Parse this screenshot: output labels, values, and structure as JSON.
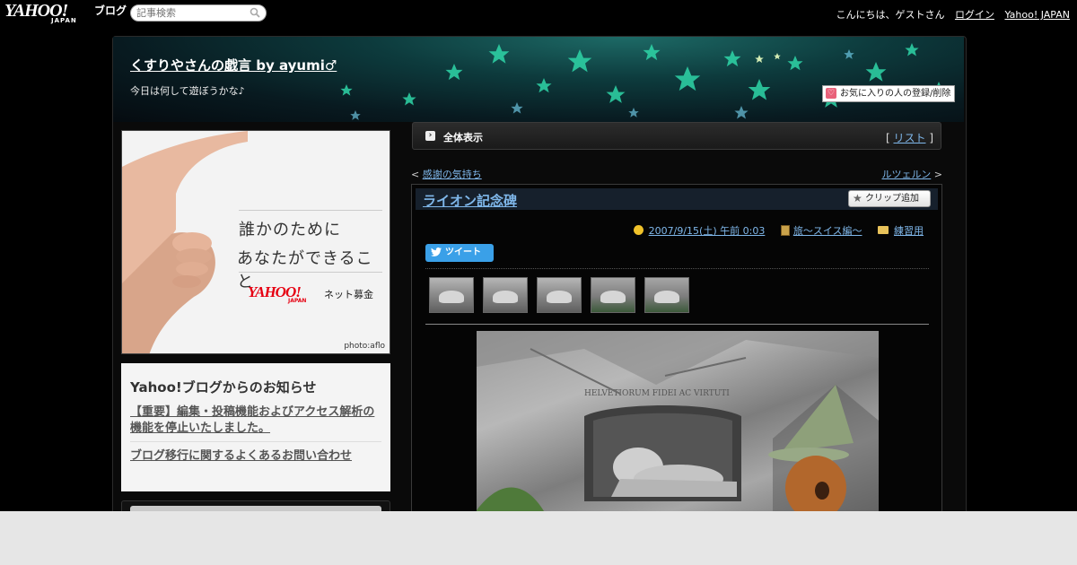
{
  "topbar": {
    "logo_text": "YAHOO!",
    "logo_sub": "JAPAN",
    "logo_blog": "ブログ",
    "search_placeholder": "記事検索",
    "greeting": "こんにちは、ゲストさん",
    "login": "ログイン",
    "yahoo_japan": "Yahoo! JAPAN"
  },
  "header": {
    "title": "くすりやさんの戯言 by ayumi♂",
    "subtitle": "今日は何して遊ぼうかな♪",
    "fav_button": "お気に入りの人の登録/削除"
  },
  "ad": {
    "line1": "誰かのために",
    "line2": "あなたができること",
    "brand": "YAHOO!",
    "brand_sub": "JAPAN",
    "service": "ネット募金",
    "credit": "photo:aflo"
  },
  "notice": {
    "heading": "Yahoo!ブログからのお知らせ",
    "links": [
      "【重要】編集・投稿機能およびアクセス解析の機能を停止いたしました。",
      "ブログ移行に関するよくあるお問い合わせ"
    ]
  },
  "viewbar": {
    "label": "全体表示",
    "list_open": "[ ",
    "list_label": "リスト",
    "list_close": " ]"
  },
  "nav": {
    "prev_arrow": "< ",
    "prev": "感謝の気持ち",
    "next": "ルツェルン",
    "next_arrow": " >"
  },
  "article": {
    "title": "ライオン記念碑",
    "clip_button": "クリップ追加",
    "datetime": "2007/9/15(土) 午前 0:03",
    "category": "旅～スイス編～",
    "folder": "練習用",
    "tweet": "ツイート",
    "inscription": "HELVETIORUM FIDEI AC VIRTUTI"
  },
  "colors": {
    "link": "#7fb7ea",
    "tweet": "#3aa0e8",
    "header_teal": "#1d6a66"
  },
  "icons": [
    "search-icon",
    "heart-icon",
    "arrow-right-icon",
    "star-icon",
    "clock-icon",
    "book-icon",
    "folder-icon",
    "twitter-bird-icon"
  ]
}
